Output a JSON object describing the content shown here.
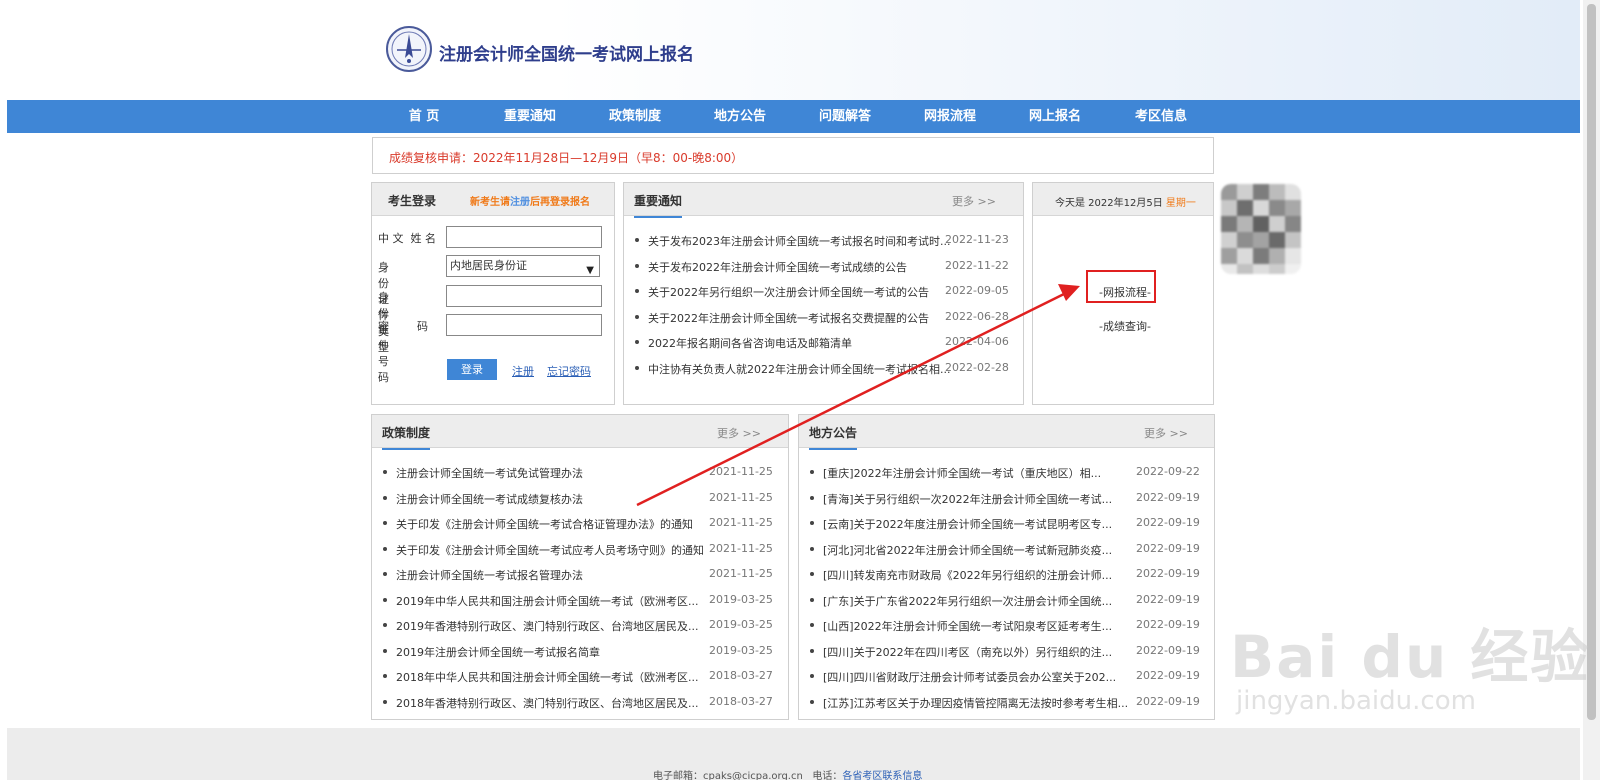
{
  "site": {
    "title": "注册会计师全国统一考试网上报名"
  },
  "nav": [
    "首 页",
    "重要通知",
    "政策制度",
    "地方公告",
    "问题解答",
    "网报流程",
    "网上报名",
    "考区信息"
  ],
  "notice": "成绩复核申请：2022年11月28日—12月9日（早8：00-晚8:00）",
  "login": {
    "title": "考生登录",
    "hint_pre": "新考生请",
    "hint_link": "注册",
    "hint_post": "后再登录报名",
    "name_label": "中 文  姓 名",
    "id_type_label": "身份证件类型",
    "id_type_value": "内地居民身份证",
    "id_no_label": "身份证件号码",
    "password_label": "密        码",
    "login_button": "登录",
    "register_link": "注册",
    "forgot_link": "忘记密码"
  },
  "important": {
    "title": "重要通知",
    "more": "更多 >>",
    "items": [
      {
        "text": "关于发布2023年注册会计师全国统一考试报名时间和考试时...",
        "date": "2022-11-23"
      },
      {
        "text": "关于发布2022年注册会计师全国统一考试成绩的公告",
        "date": "2022-11-22"
      },
      {
        "text": "关于2022年另行组织一次注册会计师全国统一考试的公告",
        "date": "2022-09-05"
      },
      {
        "text": "关于2022年注册会计师全国统一考试报名交费提醒的公告",
        "date": "2022-06-28"
      },
      {
        "text": "2022年报名期间各省咨询电话及邮箱清单",
        "date": "2022-04-06"
      },
      {
        "text": "中注协有关负责人就2022年注册会计师全国统一考试报名相...",
        "date": "2022-02-28"
      }
    ]
  },
  "sidebar": {
    "date_prefix": "今天是 2022年12月5日",
    "weekday": "星期一",
    "link1": "-网报流程-",
    "link2": "-成绩查询-"
  },
  "policy": {
    "title": "政策制度",
    "more": "更多 >>",
    "items": [
      {
        "text": "注册会计师全国统一考试免试管理办法",
        "date": "2021-11-25"
      },
      {
        "text": "注册会计师全国统一考试成绩复核办法",
        "date": "2021-11-25"
      },
      {
        "text": "关于印发《注册会计师全国统一考试合格证管理办法》的通知",
        "date": "2021-11-25"
      },
      {
        "text": "关于印发《注册会计师全国统一考试应考人员考场守则》的通知",
        "date": "2021-11-25"
      },
      {
        "text": "注册会计师全国统一考试报名管理办法",
        "date": "2021-11-25"
      },
      {
        "text": "2019年中华人民共和国注册会计师全国统一考试（欧洲考区...",
        "date": "2019-03-25"
      },
      {
        "text": "2019年香港特别行政区、澳门特别行政区、台湾地区居民及...",
        "date": "2019-03-25"
      },
      {
        "text": "2019年注册会计师全国统一考试报名简章",
        "date": "2019-03-25"
      },
      {
        "text": "2018年中华人民共和国注册会计师全国统一考试（欧洲考区...",
        "date": "2018-03-27"
      },
      {
        "text": "2018年香港特别行政区、澳门特别行政区、台湾地区居民及...",
        "date": "2018-03-27"
      }
    ]
  },
  "local": {
    "title": "地方公告",
    "more": "更多 >>",
    "items": [
      {
        "text": "[重庆]2022年注册会计师全国统一考试（重庆地区）相...",
        "date": "2022-09-22"
      },
      {
        "text": "[青海]关于另行组织一次2022年注册会计师全国统一考试...",
        "date": "2022-09-19"
      },
      {
        "text": "[云南]关于2022年度注册会计师全国统一考试昆明考区专...",
        "date": "2022-09-19"
      },
      {
        "text": "[河北]河北省2022年注册会计师全国统一考试新冠肺炎疫...",
        "date": "2022-09-19"
      },
      {
        "text": "[四川]转发南充市财政局《2022年另行组织的注册会计师...",
        "date": "2022-09-19"
      },
      {
        "text": "[广东]关于广东省2022年另行组织一次注册会计师全国统...",
        "date": "2022-09-19"
      },
      {
        "text": "[山西]2022年注册会计师全国统一考试阳泉考区延考考生...",
        "date": "2022-09-19"
      },
      {
        "text": "[四川]关于2022年在四川考区（南充以外）另行组织的注...",
        "date": "2022-09-19"
      },
      {
        "text": "[四川]四川省财政厅注册会计师考试委员会办公室关于202...",
        "date": "2022-09-19"
      },
      {
        "text": "[江苏]江苏考区关于办理因疫情管控隔离无法按时参考考生相...",
        "date": "2022-09-19"
      }
    ]
  },
  "footer": {
    "email_label": "电子邮箱：",
    "email": "cpaks@cicpa.org.cn",
    "phone_label": "电话：",
    "phone_link": "各省考区联系信息"
  },
  "watermark": {
    "main": "Bai du 经验",
    "sub": "jingyan.baidu.com"
  },
  "colors": {
    "nav": "#3f86d6",
    "notice_red": "#d93a2b",
    "hint_orange": "#f07a19",
    "annotation_red": "#e02020"
  }
}
